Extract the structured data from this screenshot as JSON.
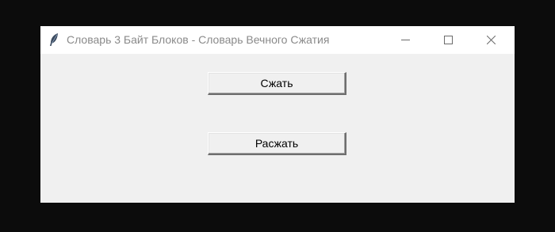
{
  "window": {
    "title": "Словарь 3 Байт Блоков - Словарь Вечного Сжатия",
    "icon": "feather-icon",
    "controls": [
      "minimize-icon",
      "maximize-icon",
      "close-icon"
    ]
  },
  "buttons": {
    "compress_label": "Сжать",
    "decompress_label": "Расжать"
  },
  "colors": {
    "desktop": "#0c0c0c",
    "titlebar": "#ffffff",
    "window_bg": "#f0f0f0",
    "title_text": "#8a8a8a"
  }
}
